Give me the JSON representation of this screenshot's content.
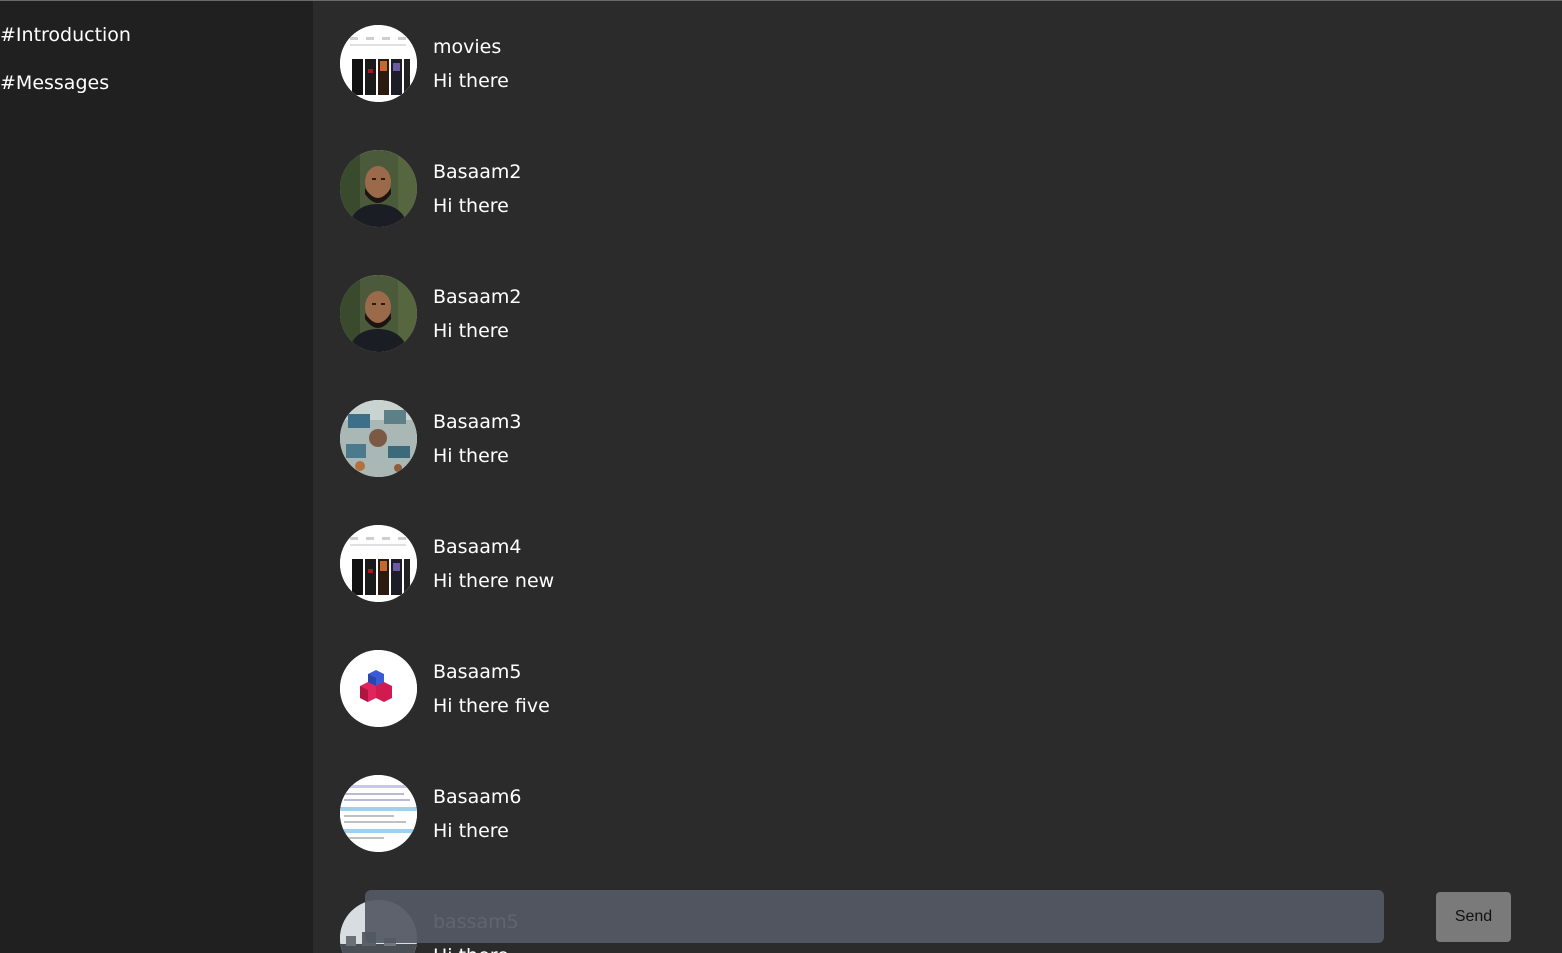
{
  "sidebar": {
    "channels": [
      {
        "label": "#Introduction"
      },
      {
        "label": "#Messages"
      }
    ]
  },
  "messages": [
    {
      "username": "movies",
      "text": "Hi there",
      "avatar": "movie-posters-image"
    },
    {
      "username": "Basaam2",
      "text": "Hi there",
      "avatar": "man-portrait-photo"
    },
    {
      "username": "Basaam2",
      "text": "Hi there",
      "avatar": "man-portrait-photo"
    },
    {
      "username": "Basaam3",
      "text": "Hi there",
      "avatar": "workspace-desk-photo"
    },
    {
      "username": "Basaam4",
      "text": "Hi there new",
      "avatar": "movie-posters-image"
    },
    {
      "username": "Basaam5",
      "text": "Hi there five",
      "avatar": "stacked-cubes-logo"
    },
    {
      "username": "Basaam6",
      "text": "Hi there",
      "avatar": "document-screenshot-image"
    },
    {
      "username": "bassam5",
      "text": "Hi there",
      "avatar": "landscape-photo"
    }
  ],
  "composer": {
    "placeholder": "",
    "send_label": "Send"
  }
}
